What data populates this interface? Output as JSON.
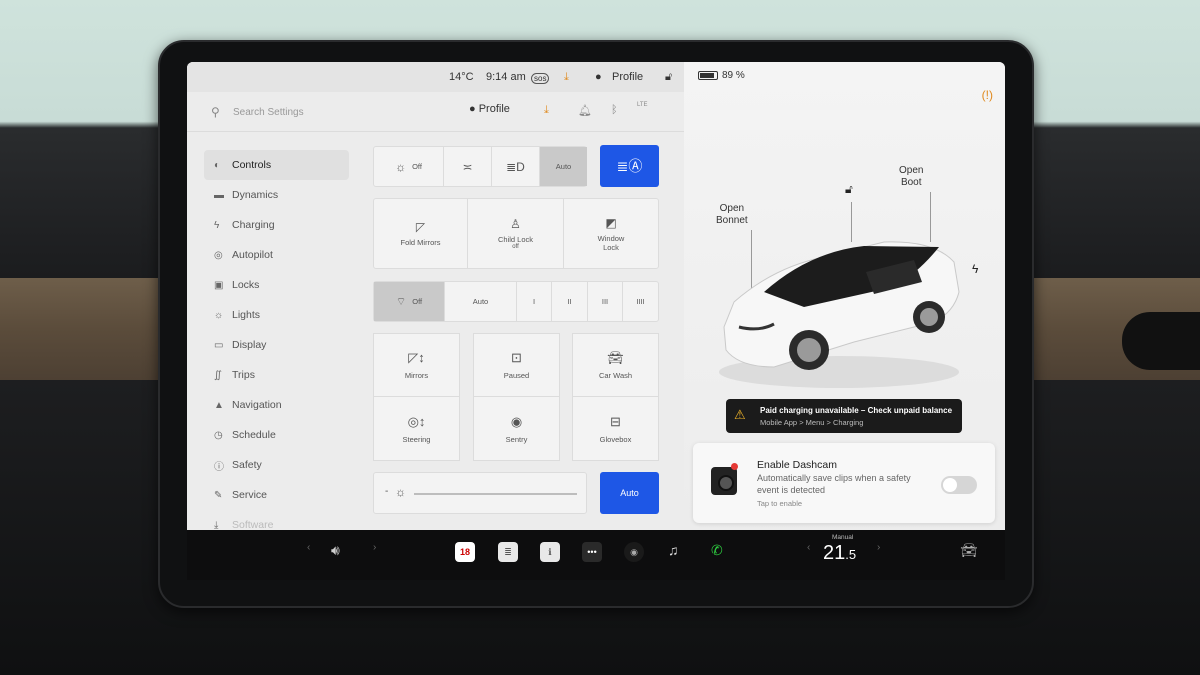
{
  "status": {
    "temperature": "14°C",
    "time": "9:14 am",
    "sos": "sos",
    "profile": "Profile",
    "battery_percent": "89 %",
    "battery_level": 0.89
  },
  "search": {
    "placeholder": "Search Settings",
    "profile": "Profile",
    "lte": "LTE"
  },
  "sidebar": {
    "items": [
      {
        "label": "Controls",
        "icon": "toggle-icon",
        "active": true
      },
      {
        "label": "Dynamics",
        "icon": "car-icon"
      },
      {
        "label": "Charging",
        "icon": "bolt-icon"
      },
      {
        "label": "Autopilot",
        "icon": "steering-wheel-icon"
      },
      {
        "label": "Locks",
        "icon": "lock-icon"
      },
      {
        "label": "Lights",
        "icon": "sun-icon"
      },
      {
        "label": "Display",
        "icon": "display-icon"
      },
      {
        "label": "Trips",
        "icon": "trips-icon"
      },
      {
        "label": "Navigation",
        "icon": "navigation-arrow-icon"
      },
      {
        "label": "Schedule",
        "icon": "clock-icon"
      },
      {
        "label": "Safety",
        "icon": "info-icon"
      },
      {
        "label": "Service",
        "icon": "wrench-icon"
      },
      {
        "label": "Software",
        "icon": "download-icon"
      }
    ]
  },
  "lights_row": {
    "off": "Off",
    "auto": "Auto",
    "selected": "Auto"
  },
  "locks_row": {
    "fold_mirrors": "Fold Mirrors",
    "child_lock": "Child Lock",
    "child_lock_state": "off",
    "window_lock": "Window Lock"
  },
  "wipers_row": {
    "off": "Off",
    "auto": "Auto",
    "speeds": [
      "I",
      "II",
      "III",
      "IIII"
    ],
    "selected": "Off"
  },
  "grid": {
    "mirrors": "Mirrors",
    "paused": "Paused",
    "car_wash": "Car Wash",
    "steering": "Steering",
    "sentry": "Sentry",
    "glovebox": "Glovebox"
  },
  "brightness": {
    "minus": "-",
    "auto": "Auto"
  },
  "car_view": {
    "bonnet": [
      "Open",
      "Bonnet"
    ],
    "boot": [
      "Open",
      "Boot"
    ]
  },
  "alert": {
    "title": "Paid charging unavailable – Check unpaid balance",
    "subtitle": "Mobile App > Menu > Charging"
  },
  "dashcam": {
    "title": "Enable Dashcam",
    "description": "Automatically save clips when a safety event is detected",
    "tap": "Tap to enable",
    "enabled": false
  },
  "taskbar": {
    "calendar_day": "18",
    "climate_mode": "Manual",
    "temp_main": "21",
    "temp_decimal": ".5"
  },
  "colors": {
    "accent": "#1e57e6",
    "warning": "#e08a1e",
    "alert_icon": "#f0b429"
  }
}
